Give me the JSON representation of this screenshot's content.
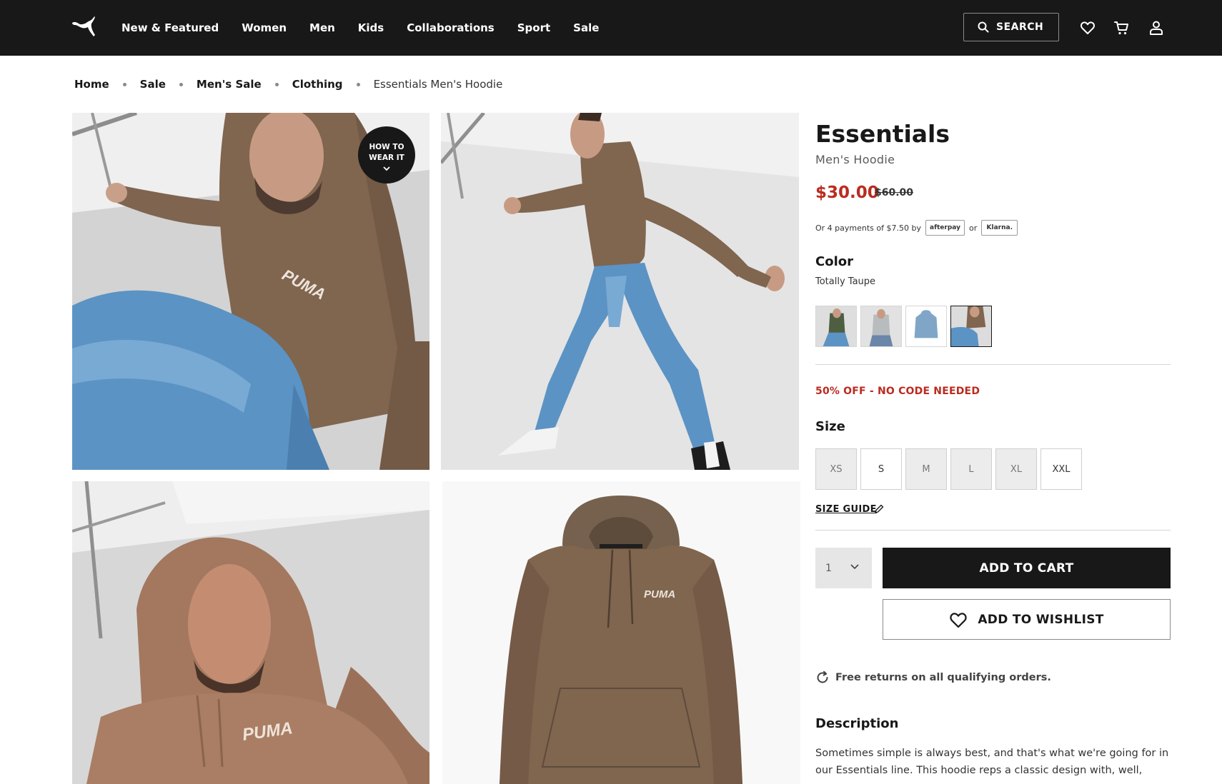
{
  "header": {
    "brand": "PUMA",
    "nav": [
      "New & Featured",
      "Women",
      "Men",
      "Kids",
      "Collaborations",
      "Sport",
      "Sale"
    ],
    "search_label": "SEARCH",
    "icons": [
      "search-icon",
      "heart-icon",
      "cart-icon",
      "account-icon"
    ]
  },
  "breadcrumb": {
    "items": [
      "Home",
      "Sale",
      "Men's Sale",
      "Clothing"
    ],
    "current": "Essentials Men's Hoodie"
  },
  "gallery": {
    "how_to_line1": "HOW TO",
    "how_to_line2": "WEAR IT",
    "hoodie_brand_print": "PUMA"
  },
  "product": {
    "title": "Essentials",
    "subtitle": "Men's Hoodie",
    "price_sale": "$30.00",
    "price_original": "$60.00",
    "installments_prefix": "Or 4 payments of $7.50 by",
    "installments_or": "or",
    "afterpay_label": "afterpay",
    "klarna_label": "Klarna.",
    "color_label": "Color",
    "color_name": "Totally Taupe",
    "color_swatches": [
      {
        "name": "green",
        "selected": false
      },
      {
        "name": "grey",
        "selected": false
      },
      {
        "name": "blue",
        "selected": false
      },
      {
        "name": "totally-taupe",
        "selected": true
      }
    ],
    "promo": "50% OFF - NO CODE NEEDED",
    "size_label": "Size",
    "sizes": [
      {
        "label": "XS",
        "available": false
      },
      {
        "label": "S",
        "available": true
      },
      {
        "label": "M",
        "available": false
      },
      {
        "label": "L",
        "available": false
      },
      {
        "label": "XL",
        "available": false
      },
      {
        "label": "XXL",
        "available": true
      }
    ],
    "size_guide": "SIZE GUIDE",
    "quantity": "1",
    "add_to_cart": "ADD TO CART",
    "add_to_wishlist": "ADD TO WISHLIST",
    "returns": "Free returns on all qualifying orders.",
    "description_title": "Description",
    "description_text": "Sometimes simple is always best, and that's what we're going for in our Essentials line. This hoodie reps a classic design with, well,"
  },
  "colors": {
    "header_bg": "#181818",
    "sale_red": "#ba2b20",
    "hoodie_brown": "#80654f",
    "denim": "#5b93c4"
  }
}
